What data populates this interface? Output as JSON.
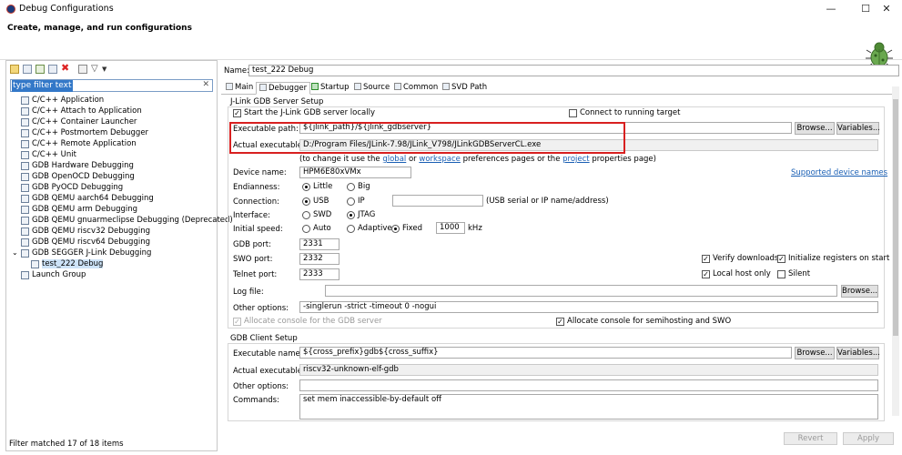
{
  "window": {
    "title": "Debug Configurations",
    "minimize": "—",
    "maximize": "☐",
    "close": "✕"
  },
  "header": {
    "title": "Create, manage, and run configurations"
  },
  "filter": {
    "placeholder": "type filter text",
    "clear": "✕"
  },
  "tree": [
    "C/C++ Application",
    "C/C++ Attach to Application",
    "C/C++ Container Launcher",
    "C/C++ Postmortem Debugger",
    "C/C++ Remote Application",
    "C/C++ Unit",
    "GDB Hardware Debugging",
    "GDB OpenOCD Debugging",
    "GDB PyOCD Debugging",
    "GDB QEMU aarch64 Debugging",
    "GDB QEMU arm Debugging",
    "GDB QEMU gnuarmeclipse Debugging (Deprecated)",
    "GDB QEMU riscv32 Debugging",
    "GDB QEMU riscv64 Debugging",
    "GDB SEGGER J-Link Debugging",
    "test_222 Debug",
    "Launch Group"
  ],
  "status": "Filter matched 17 of 18 items",
  "name": {
    "label": "Name:",
    "value": "test_222 Debug"
  },
  "tabs": [
    "Main",
    "Debugger",
    "Startup",
    "Source",
    "Common",
    "SVD Path"
  ],
  "server": {
    "group": "J-Link GDB Server Setup",
    "start_local": "Start the J-Link GDB server locally",
    "connect_running": "Connect to running target",
    "exe_label": "Executable path:",
    "exe_value": "${jlink_path}/${jlink_gdbserver}",
    "actual_label": "Actual executable:",
    "actual_value": "D:/Program Files/JLink-7.98/JLink_V798/JLinkGDBServerCL.exe",
    "hint_a": "(to change it use the ",
    "hint_global": "global",
    "hint_or": " or ",
    "hint_workspace": "workspace",
    "hint_mid": " preferences pages or the ",
    "hint_project": "project",
    "hint_end": " properties page)",
    "browse": "Browse...",
    "variables": "Variables...",
    "device_label": "Device name:",
    "device_value": "HPM6E80xVMx",
    "supported": "Supported device names",
    "endian_label": "Endianness:",
    "little": "Little",
    "big": "Big",
    "conn_label": "Connection:",
    "usb": "USB",
    "ip": "IP",
    "conn_hint": "(USB serial or IP name/address)",
    "iface_label": "Interface:",
    "swd": "SWD",
    "jtag": "JTAG",
    "speed_label": "Initial speed:",
    "auto": "Auto",
    "adaptive": "Adaptive",
    "fixed": "Fixed",
    "speed_value": "1000",
    "khz": "kHz",
    "gdbport_label": "GDB port:",
    "gdbport": "2331",
    "swoport_label": "SWO port:",
    "swoport": "2332",
    "telnet_label": "Telnet port:",
    "telnet": "2333",
    "verify": "Verify downloads",
    "init_regs": "Initialize registers on start",
    "localhost": "Local host only",
    "silent": "Silent",
    "log_label": "Log file:",
    "other_label": "Other options:",
    "other_value": "-singlerun -strict -timeout 0 -nogui",
    "alloc_gdb": "Allocate console for the GDB server",
    "alloc_semi": "Allocate console for semihosting and SWO"
  },
  "client": {
    "group": "GDB Client Setup",
    "exe_label": "Executable name:",
    "exe_value": "${cross_prefix}gdb${cross_suffix}",
    "actual_label": "Actual executable:",
    "actual_value": "riscv32-unknown-elf-gdb",
    "other_label": "Other options:",
    "commands_label": "Commands:",
    "commands_value": "set mem inaccessible-by-default off"
  },
  "footer": {
    "revert": "Revert",
    "apply": "Apply"
  }
}
